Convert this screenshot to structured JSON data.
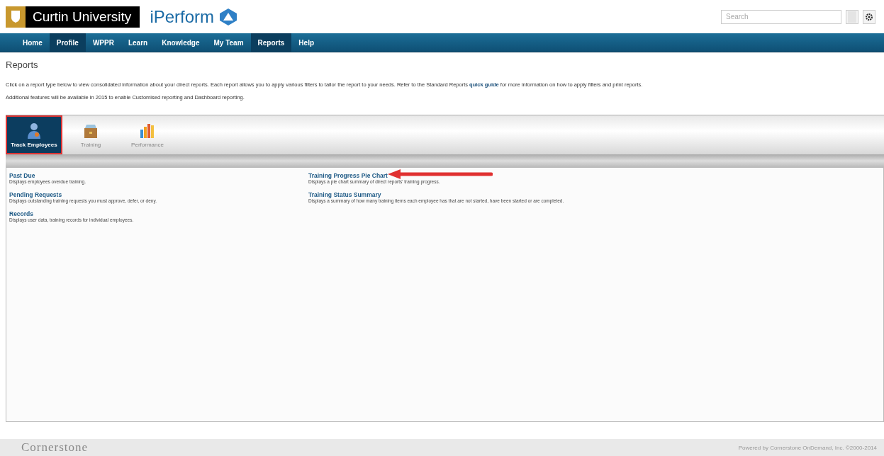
{
  "header": {
    "university": "Curtin University",
    "product": "iPerform",
    "search": {
      "placeholder": "Search"
    }
  },
  "nav": [
    {
      "label": "Home",
      "selected": false
    },
    {
      "label": "Profile",
      "selected": true
    },
    {
      "label": "WPPR",
      "selected": false
    },
    {
      "label": "Learn",
      "selected": false
    },
    {
      "label": "Knowledge",
      "selected": false
    },
    {
      "label": "My Team",
      "selected": false
    },
    {
      "label": "Reports",
      "selected": true
    },
    {
      "label": "Help",
      "selected": false
    }
  ],
  "page": {
    "title": "Reports",
    "intro": "Click on a report type below to view consolidated information about your direct reports. Each report allows you to apply various filters to tailor the report to your needs. Refer to the Standard Reports **quick guide** for more information on how to apply filters and print reports.",
    "note": "Additional features will be available in 2015 to enable Customised reporting and Dashboard reporting."
  },
  "report_types": [
    {
      "label": "Track Employees",
      "kind": "person",
      "selected": true
    },
    {
      "label": "Training",
      "kind": "box",
      "selected": false
    },
    {
      "label": "Performance",
      "kind": "chart",
      "selected": false
    }
  ],
  "reports": [
    [
      {
        "title": "Past Due",
        "description": "Displays employees overdue training."
      },
      {
        "title": "Pending Requests",
        "description": "Displays outstanding training requests you must approve, defer, or deny."
      },
      {
        "title": "Records",
        "description": "Displays user data, training records for individual employees."
      }
    ],
    [
      {
        "title": "Training Progress Pie Chart",
        "description": "Displays a pie chart summary of direct reports' training progress.",
        "annotated": true
      },
      {
        "title": "Training Status Summary",
        "description": "Displays a summary of how many training items each employee has that are not started, have been started or are completed."
      }
    ]
  ],
  "footer": {
    "logo": "Cornerstone",
    "credit": "Powered by Cornerstone OnDemand, Inc. ©2000-2014"
  }
}
